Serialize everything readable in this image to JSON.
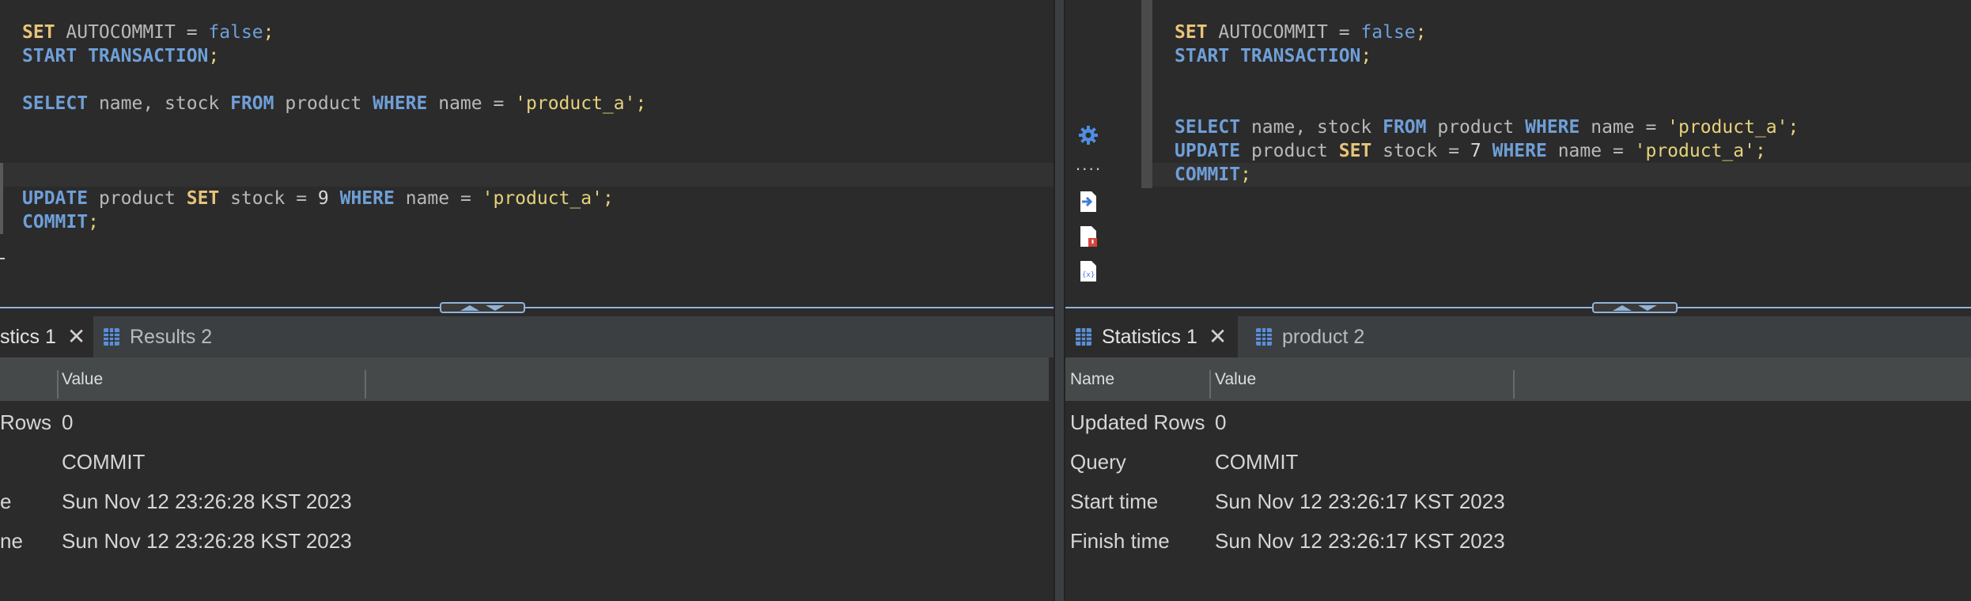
{
  "left": {
    "code": {
      "line1": {
        "kw": "SET",
        "rest": " AUTOCOMMIT = ",
        "bool": "false",
        "semi": ";"
      },
      "line2": {
        "kw": "START TRANSACTION",
        "semi": ";"
      },
      "line4": {
        "kw1": "SELECT",
        "p1": " name, stock ",
        "kw2": "FROM",
        "p2": " product ",
        "kw3": "WHERE",
        "p3": " name = ",
        "str": "'product_a'",
        "semi": ";"
      },
      "line8": {
        "kw1": "UPDATE",
        "p1": " product ",
        "kw2": "SET",
        "p2": " stock = ",
        "num": "9",
        "p3": " ",
        "kw3": "WHERE",
        "p4": " name = ",
        "str": "'product_a'",
        "semi": ";"
      },
      "line9": {
        "kw": "COMMIT",
        "semi": ";"
      }
    },
    "tabs": [
      {
        "label": "stics 1",
        "active": true
      },
      {
        "label": "Results 2",
        "active": false
      }
    ],
    "results": {
      "columns": [
        "",
        "Value"
      ],
      "rows": [
        [
          "Rows",
          "0"
        ],
        [
          "",
          "COMMIT"
        ],
        [
          "e",
          "Sun Nov 12 23:26:28 KST 2023"
        ],
        [
          "ne",
          "Sun Nov 12 23:26:28 KST 2023"
        ]
      ]
    }
  },
  "right": {
    "toolbar_icons": [
      "gear-icon",
      "more-dots-icon",
      "export-icon",
      "file-error-icon",
      "file-variables-icon"
    ],
    "code": {
      "line1": {
        "kw": "SET",
        "rest": " AUTOCOMMIT = ",
        "bool": "false",
        "semi": ";"
      },
      "line2": {
        "kw": "START TRANSACTION",
        "semi": ";"
      },
      "line5": {
        "kw1": "SELECT",
        "p1": " name, stock ",
        "kw2": "FROM",
        "p2": " product ",
        "kw3": "WHERE",
        "p3": " name = ",
        "str": "'product_a'",
        "semi": ";"
      },
      "line6": {
        "kw1": "UPDATE",
        "p1": " product ",
        "kw2": "SET",
        "p2": " stock = ",
        "num": "7",
        "p3": " ",
        "kw3": "WHERE",
        "p4": " name = ",
        "str": "'product_a'",
        "semi": ";"
      },
      "line7": {
        "kw": "COMMIT",
        "semi": ";"
      }
    },
    "tabs": [
      {
        "label": "Statistics 1",
        "active": true
      },
      {
        "label": "product 2",
        "active": false
      }
    ],
    "results": {
      "columns": [
        "Name",
        "Value"
      ],
      "rows": [
        [
          "Updated Rows",
          "0"
        ],
        [
          "Query",
          "COMMIT"
        ],
        [
          "Start time",
          "Sun Nov 12 23:26:17 KST 2023"
        ],
        [
          "Finish time",
          "Sun Nov 12 23:26:17 KST 2023"
        ]
      ]
    }
  },
  "colors": {
    "keyword_yellow": "#e8c47a",
    "keyword_blue": "#6f9fd8",
    "string": "#e6d27a",
    "accent": "#8fb3d9"
  }
}
